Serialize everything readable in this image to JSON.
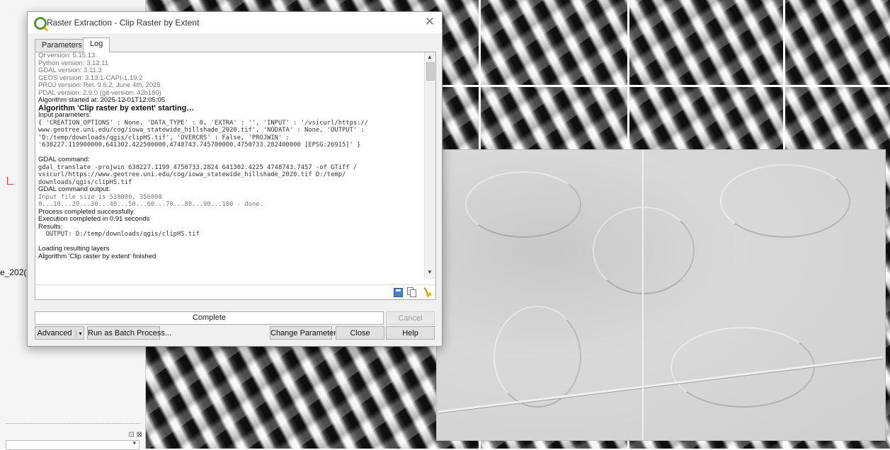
{
  "dialog": {
    "title": "Raster Extraction - Clip Raster by Extent",
    "close_glyph": "✕",
    "tabs": [
      {
        "label": "Parameters",
        "active": false
      },
      {
        "label": "Log",
        "active": true
      }
    ],
    "log_lines": [
      {
        "text": "Qt version: 5.15.13",
        "style": "gray"
      },
      {
        "text": "Python version: 3.12.11",
        "style": "gray"
      },
      {
        "text": "GDAL version: 3.11.3",
        "style": "gray"
      },
      {
        "text": "GEOS version: 3.13.1-CAPI-1.19.2",
        "style": "gray"
      },
      {
        "text": "PROJ version: Rel. 9.6.2, June 4th, 2025",
        "style": "gray"
      },
      {
        "text": "PDAL version: 2.9.0 (git-version: 42b180)",
        "style": "gray"
      },
      {
        "text": "Algorithm started at: 2025-12-01T12:05:05",
        "style": "dark"
      },
      {
        "text": "Algorithm 'Clip raster by extent' starting…",
        "style": "bold"
      },
      {
        "text": "Input parameters:",
        "style": "dark"
      },
      {
        "text": "{ 'CREATION_OPTIONS' : None, 'DATA_TYPE' : 0, 'EXTRA' : '', 'INPUT' : '/vsicurl/https://",
        "style": "mono"
      },
      {
        "text": "www.geotree.uni.edu/cog/iowa_statewide_hillshade_2020.tif', 'NODATA' : None, 'OUTPUT' :",
        "style": "mono"
      },
      {
        "text": "'D:/temp/downloads/qgis/clipHS.tif', 'OVERCRS' : False, 'PROJWIN' :",
        "style": "mono"
      },
      {
        "text": "'638227.119900000,641302.422500000,4748743.745700000,4750733.282400000 [EPSG:26915]' }",
        "style": "mono"
      },
      {
        "text": "",
        "style": "dark"
      },
      {
        "text": "GDAL command:",
        "style": "dark"
      },
      {
        "text": "gdal_translate -projwin 638227.1199 4750733.2824 641302.4225 4748743.7457 -of GTiff /",
        "style": "mono"
      },
      {
        "text": "vsicurl/https://www.geotree.uni.edu/cog/iowa_statewide_hillshade_2020.tif D:/temp/",
        "style": "mono"
      },
      {
        "text": "downloads/qgis/clipHS.tif",
        "style": "mono"
      },
      {
        "text": "GDAL command output:",
        "style": "dark"
      },
      {
        "text": "Input file size is 538000, 356000",
        "style": "mono gray"
      },
      {
        "text": "0...10...20...30...40...50...60...70...80...90...100 - done.",
        "style": "mono gray"
      },
      {
        "text": "Process completed successfully",
        "style": "dark"
      },
      {
        "text": "Execution completed in 0.91 seconds",
        "style": "dark"
      },
      {
        "text": "Results:",
        "style": "dark"
      },
      {
        "text": "  OUTPUT: D:/temp/downloads/qgis/clipHS.tif",
        "style": "mono"
      },
      {
        "text": "",
        "style": "dark"
      },
      {
        "text": "Loading resulting layers",
        "style": "dark"
      },
      {
        "text": "Algorithm 'Clip raster by extent' finished",
        "style": "dark"
      }
    ],
    "progress_label": "Complete",
    "buttons": {
      "cancel": "Cancel",
      "advanced": "Advanced",
      "advanced_arrow": "▾",
      "batch": "Run as Batch Process...",
      "change_params": "Change Parameters",
      "close": "Close",
      "help": "Help"
    }
  },
  "left_panel": {
    "truncated_label": "e_202(",
    "dock_controls": "⊡ ⊠",
    "scroll_arrow": "▾"
  },
  "colors": {
    "qgis_green": "#589632",
    "dialog_bg": "#f0f0f0",
    "button_bg": "#e1e1e1"
  }
}
